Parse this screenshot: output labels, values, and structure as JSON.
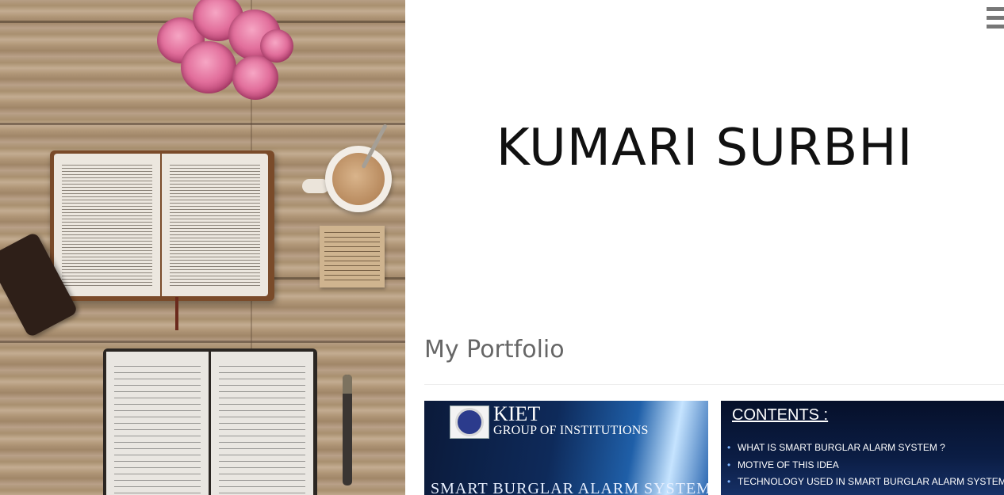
{
  "header": {
    "site_title": "KUMARI SURBHI",
    "menu_icon": "hamburger-icon"
  },
  "portfolio": {
    "heading": "My Portfolio",
    "items": [
      {
        "org_name": "KIET",
        "org_subtitle": "GROUP OF INSTITUTIONS",
        "slide_title": "SMART BURGLAR ALARM SYSTEM"
      },
      {
        "title": "CONTENTS :",
        "bullets": [
          "WHAT IS SMART BURGLAR ALARM SYSTEM ?",
          "MOTIVE OF THIS IDEA",
          "TECHNOLOGY USED IN SMART BURGLAR ALARM SYSTEM"
        ]
      }
    ]
  },
  "colors": {
    "title": "#111111",
    "heading": "#666666",
    "menu": "#777777"
  }
}
